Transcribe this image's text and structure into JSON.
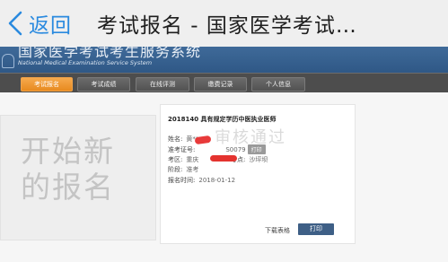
{
  "header": {
    "back_label": "返回",
    "title": "考试报名 - 国家医学考试…"
  },
  "site": {
    "cn_title": "国家医学考试考生服务系统",
    "en_title": "National Medical Examination Service System"
  },
  "nav": {
    "items": [
      {
        "label": "考试报名",
        "active": true
      },
      {
        "label": "考试成绩",
        "active": false
      },
      {
        "label": "在线评测",
        "active": false
      },
      {
        "label": "缴费记录",
        "active": false
      },
      {
        "label": "个人信息",
        "active": false
      }
    ]
  },
  "new_registration": {
    "label": "开始新的报名"
  },
  "record": {
    "title": "2018140 具有规定学历中医执业医师",
    "name_label": "姓名:",
    "name_value": "黄**",
    "ticket_label": "准考证号:",
    "ticket_value": "S0079",
    "ticket_print": "打印",
    "area_label": "考区:",
    "area_value": "重庆",
    "site_label": "考点:",
    "site_value": "沙坪坝",
    "stage_label": "阶段:",
    "stage_value": "准考",
    "date_label": "报名时间:",
    "date_value": "2018-01-12",
    "watermark": "审核通过",
    "download_label": "下载表格",
    "print_label": "打印"
  },
  "colors": {
    "accent_blue": "#2a8adf",
    "nav_active": "#e88a1f",
    "banner": "#3f6a99",
    "print_button": "#3e5f86",
    "redaction": "#e4332f"
  }
}
